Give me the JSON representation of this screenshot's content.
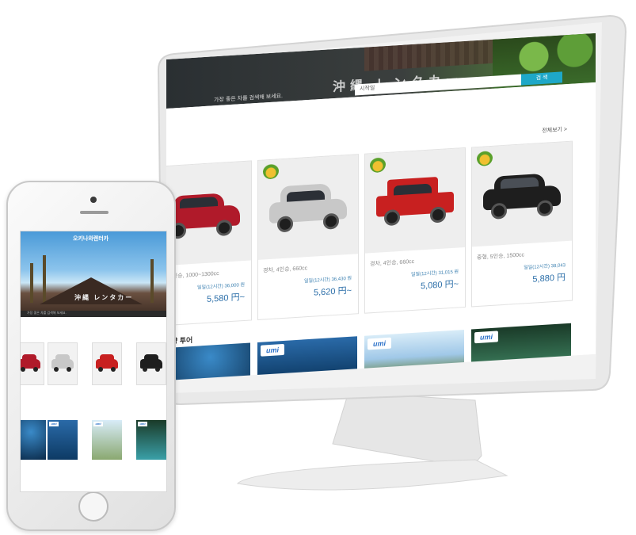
{
  "desktop": {
    "hero_title": "沖縄 レンタカー",
    "hero_text": "가장 좋은 차를 검색해 보세요.",
    "search_placeholder": "시작일",
    "search_button": "검 색",
    "view_all": "전체보기 >",
    "cars": [
      {
        "spec": "경차, 4인승, 1000~1300cc",
        "rate": "일일(12시간) 36,000 원",
        "price": "5,580 円~",
        "color": "#b01a2a"
      },
      {
        "spec": "경차, 4인승, 660cc",
        "rate": "일일(12시간) 36,430 원",
        "price": "5,620 円~",
        "color": "#c8c8c8"
      },
      {
        "spec": "경차, 4인승, 660cc",
        "rate": "일일(12시간) 31,015 원",
        "price": "5,080 円~",
        "color": "#c82020"
      },
      {
        "spec": "중형, 5인승, 1500cc",
        "rate": "일일(12시간) 38,043",
        "price": "5,880 円",
        "color": "#1e1e1e"
      }
    ],
    "tour_section_title": "양 투어",
    "tour_badge": "umi"
  },
  "mobile": {
    "logo": "오키나와렌터카",
    "hero_title": "沖縄 レンタカー",
    "search_text": "가장 좋은 차를 검색해 보세요.",
    "car_colors": [
      "#b01a2a",
      "#c8c8c8",
      "#c82020",
      "#1e1e1e"
    ],
    "tour_badge": "umi"
  }
}
